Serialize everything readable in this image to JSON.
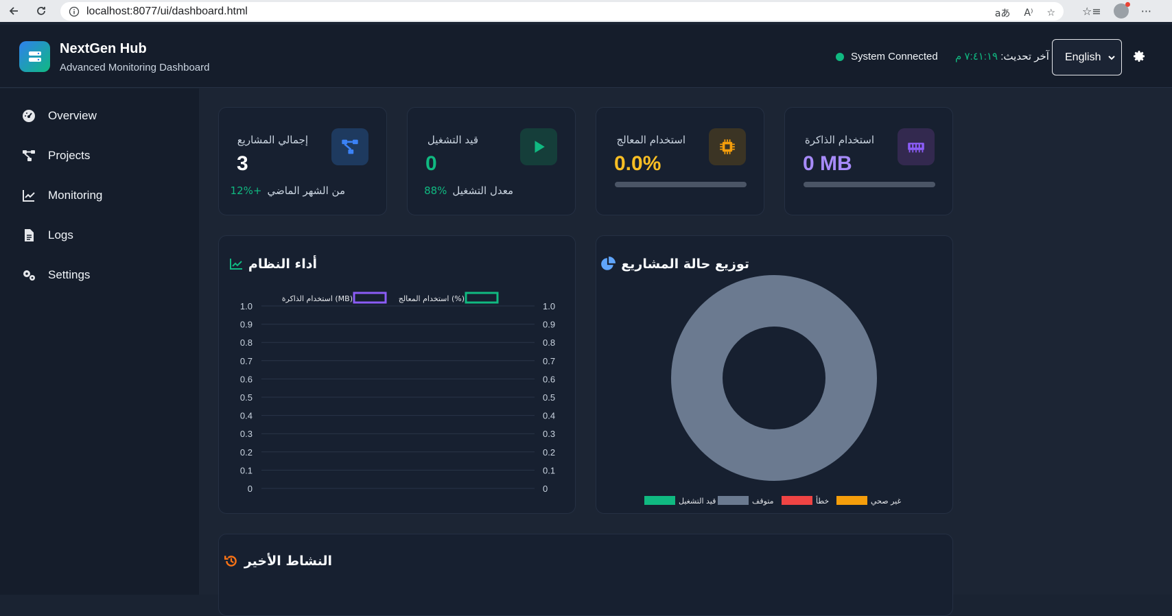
{
  "browser": {
    "url": "localhost:8077/ui/dashboard.html"
  },
  "header": {
    "brand_title": "NextGen Hub",
    "brand_subtitle": "Advanced Monitoring Dashboard",
    "status_text": "System Connected",
    "last_update_label": "آخر تحديث:",
    "last_update_time": "٧:٤١:١٩ م",
    "language": "English"
  },
  "sidebar": {
    "items": [
      {
        "label": "Overview",
        "icon": "dashboard-icon"
      },
      {
        "label": "Projects",
        "icon": "project-diagram-icon"
      },
      {
        "label": "Monitoring",
        "icon": "chart-line-icon"
      },
      {
        "label": "Logs",
        "icon": "file-icon"
      },
      {
        "label": "Settings",
        "icon": "cogs-icon"
      }
    ]
  },
  "stats": [
    {
      "title": "إجمالي المشاريع",
      "value": "3",
      "foot_pct": "+12%",
      "foot_text": "من الشهر الماضي",
      "color": "#ffffff",
      "icon_color": "#3b82f6"
    },
    {
      "title": "قيد التشغيل",
      "value": "0",
      "foot_pct": "88%",
      "foot_text": "معدل التشغيل",
      "color": "#10b981",
      "icon_color": "#10b981"
    },
    {
      "title": "استخدام المعالج",
      "value": "0.0%",
      "progress": 0,
      "color": "#fbbf24",
      "icon_color": "#f59e0b"
    },
    {
      "title": "استخدام الذاكرة",
      "value": "0 MB",
      "progress": 0,
      "color": "#a78bfa",
      "icon_color": "#8b5cf6"
    }
  ],
  "performance_panel": {
    "title": "أداء النظام",
    "legend": [
      {
        "label": "استخدام المعالج (%)",
        "color": "#10b981"
      },
      {
        "label": "استخدام الذاكرة (MB)",
        "color": "#8b5cf6"
      }
    ]
  },
  "distribution_panel": {
    "title": "توزيع حالة المشاريع",
    "legend": [
      {
        "label": "قيد التشغيل",
        "color": "#10b981"
      },
      {
        "label": "متوقف",
        "color": "#6b7a90"
      },
      {
        "label": "خطأ",
        "color": "#ef4444"
      },
      {
        "label": "غير صحي",
        "color": "#f59e0b"
      }
    ]
  },
  "activity_panel": {
    "title": "النشاط الأخير"
  },
  "chart_data": [
    {
      "type": "line",
      "title": "أداء النظام",
      "series": [
        {
          "name": "استخدام المعالج (%)",
          "values": []
        },
        {
          "name": "استخدام الذاكرة (MB)",
          "values": []
        }
      ],
      "y_ticks_left": [
        "1.0",
        "0.9",
        "0.8",
        "0.7",
        "0.6",
        "0.5",
        "0.4",
        "0.3",
        "0.2",
        "0.1",
        "0"
      ],
      "y_ticks_right": [
        "1.0",
        "0.9",
        "0.8",
        "0.7",
        "0.6",
        "0.5",
        "0.4",
        "0.3",
        "0.2",
        "0.1",
        "0"
      ],
      "ylim": [
        0,
        1
      ],
      "grid": true,
      "legend_position": "top"
    },
    {
      "type": "pie",
      "title": "توزيع حالة المشاريع",
      "categories": [
        "قيد التشغيل",
        "متوقف",
        "خطأ",
        "غير صحي"
      ],
      "values": [
        0,
        3,
        0,
        0
      ],
      "donut": true,
      "legend_position": "bottom"
    }
  ]
}
